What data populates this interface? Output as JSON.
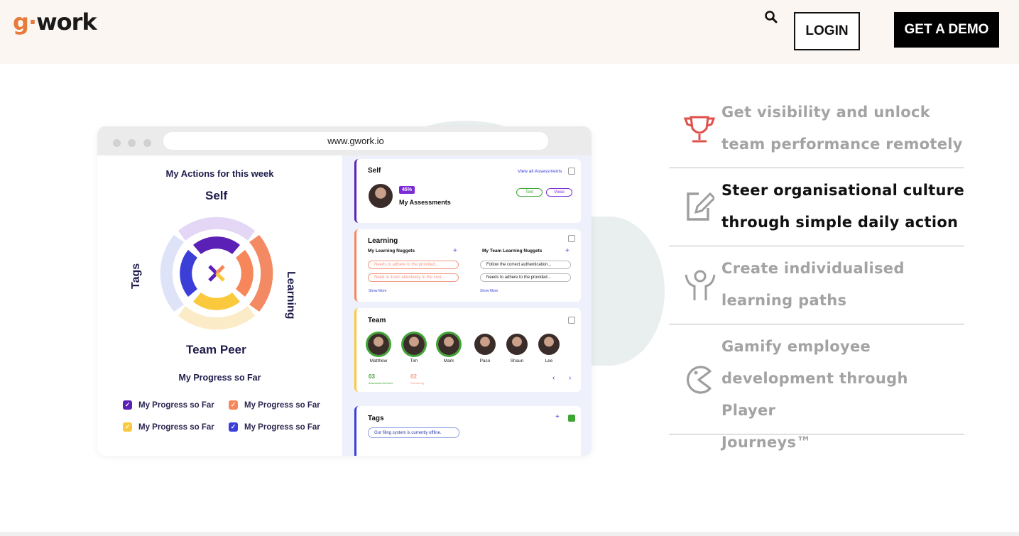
{
  "header": {
    "logo": {
      "g": "g",
      "dot": "·",
      "rest": "work"
    },
    "login_label": "LOGIN",
    "demo_label": "GET A DEMO"
  },
  "browser": {
    "url": "www.gwork.io"
  },
  "left_panel": {
    "title": "My Actions for this week",
    "ring_labels": {
      "top": "Self",
      "right": "Learning",
      "bottom": "Team Peer",
      "left": "Tags"
    },
    "progress_title": "My Progress so Far",
    "legend": [
      {
        "label": "My Progress so Far",
        "color": "#5b21b6"
      },
      {
        "label": "My Progress so Far",
        "color": "#f7865b"
      },
      {
        "label": "My Progress so Far",
        "color": "#fbc93d"
      },
      {
        "label": "My Progress so Far",
        "color": "#3b3fd8"
      }
    ]
  },
  "cards": {
    "self": {
      "title": "Self",
      "link": "View all Assessments",
      "badge": "45%",
      "label": "My Assessments",
      "btn_text": "Text",
      "btn_voice": "Voice"
    },
    "learning": {
      "title": "Learning",
      "col1_title": "My Learning Nuggets",
      "col2_title": "My Team Learning Nuggets",
      "col1_items": [
        "Needs to adhere to the provided...",
        "Need to listen attentively to the cust..."
      ],
      "col2_items": [
        "Follow the correct authentication...",
        "Needs to adhere to the provided..."
      ],
      "show_more": "Show More"
    },
    "team": {
      "title": "Team",
      "members": [
        "Matthew",
        "Tim",
        "Mark",
        "Paco",
        "Shaun",
        "Lee"
      ],
      "stat1_value": "03",
      "stat1_label": "Assessments Done",
      "stat2_value": "02",
      "stat2_label": "Remaining"
    },
    "tags": {
      "title": "Tags",
      "pill": "Our filing system is currently offline."
    }
  },
  "features": [
    {
      "line1": "Get visibility and unlock",
      "line2": "team performance remotely",
      "line3": "",
      "active": false,
      "icon": "trophy-icon"
    },
    {
      "line1": "Steer organisational culture",
      "line2": "through simple daily action",
      "line3": "",
      "active": true,
      "icon": "edit-note-icon"
    },
    {
      "line1": "Create individualised",
      "line2": "learning paths",
      "line3": "",
      "active": false,
      "icon": "person-arms-up-icon"
    },
    {
      "line1": "Gamify employee",
      "line2": "development through Player",
      "line3": "Journeys™",
      "active": false,
      "icon": "pacman-icon"
    }
  ],
  "colors": {
    "brand_orange": "#e87b3c",
    "header_bg": "#fcf6f2",
    "trophy_red": "#e0504a",
    "muted_text": "#a3a3a3"
  }
}
